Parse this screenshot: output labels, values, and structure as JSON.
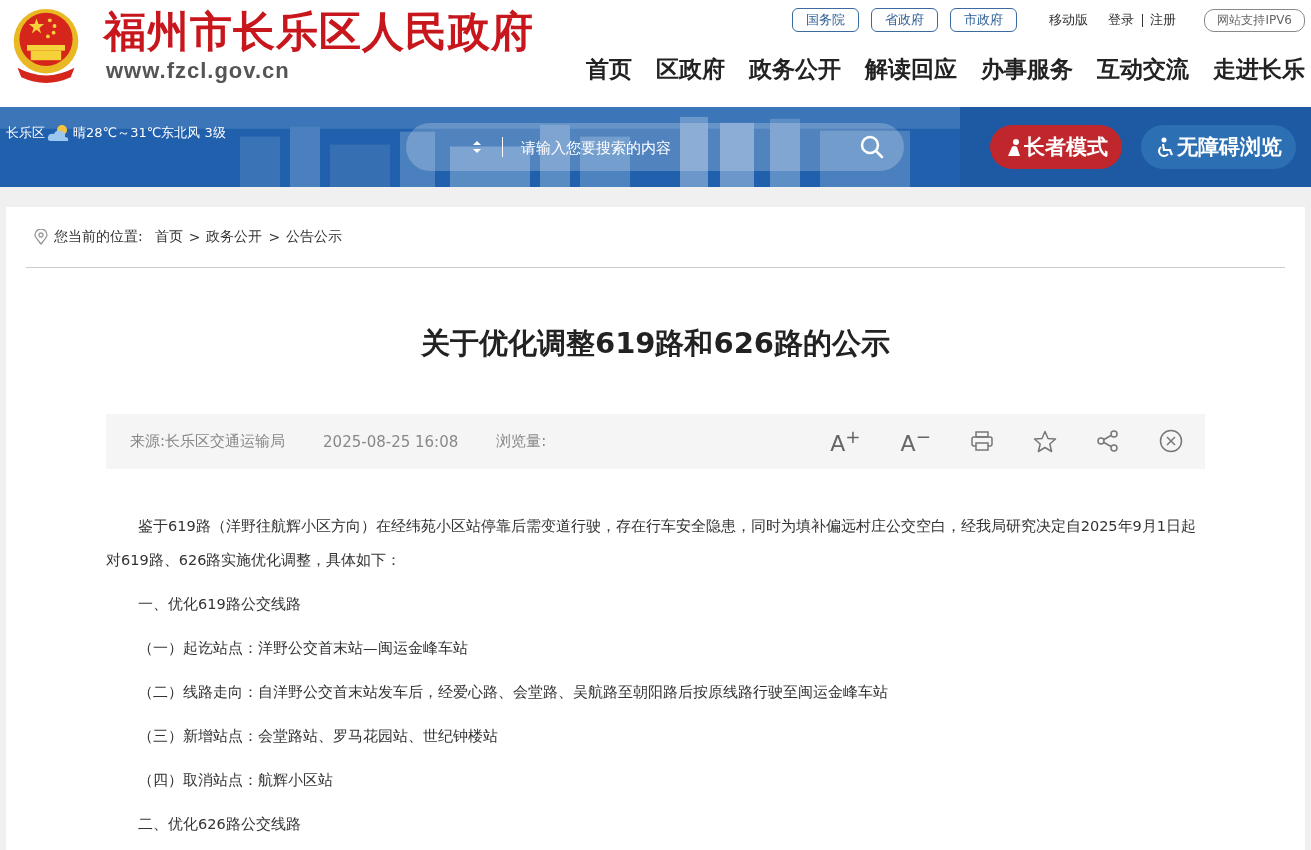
{
  "header": {
    "site_title": "福州市长乐区人民政府",
    "site_url": "www.fzcl.gov.cn",
    "gov_links": [
      {
        "label": "国务院"
      },
      {
        "label": "省政府"
      },
      {
        "label": "市政府"
      }
    ],
    "top_links": [
      {
        "label": "移动版"
      },
      {
        "label": "登录"
      },
      {
        "label": "注册"
      }
    ],
    "ipv6_badge": "网站支持IPV6",
    "nav": [
      {
        "label": "首页"
      },
      {
        "label": "区政府"
      },
      {
        "label": "政务公开"
      },
      {
        "label": "解读回应"
      },
      {
        "label": "办事服务"
      },
      {
        "label": "互动交流"
      },
      {
        "label": "走进长乐"
      }
    ]
  },
  "banner": {
    "kind": "picture",
    "location": "长乐区",
    "weather": "晴28℃～31℃东北风 3级",
    "search": {
      "placeholder": "请输入您要搜索的内容"
    },
    "elder_mode": "长者模式",
    "accessible_mode": "无障碍浏览"
  },
  "breadcrumb": {
    "label": "您当前的位置:",
    "items": [
      {
        "label": "首页"
      },
      {
        "label": "政务公开"
      },
      {
        "label": "公告公示"
      }
    ],
    "separator": ">"
  },
  "article": {
    "title": "关于优化调整619路和626路的公示",
    "meta": {
      "source": "来源:长乐区交通运输局",
      "date": "2025-08-25 16:08",
      "views_label": "浏览量:"
    },
    "tools": [
      {
        "kind": "text",
        "label": "A$^{+}$"
      },
      {
        "kind": "text",
        "label": "A$^{−}$"
      },
      {
        "kind": "print"
      },
      {
        "kind": "star"
      },
      {
        "kind": "share"
      },
      {
        "kind": "close"
      }
    ],
    "paragraphs": [
      {
        "kind": "body",
        "text": "鉴于619路（洋野往航辉小区方向）在经纬苑小区站停靠后需变道行驶，存在行车安全隐患，同时为填补偏远村庄公交空白，经我局研究决定自2025年9月1日起对619路、626路实施优化调整，具体如下："
      },
      {
        "kind": "heading",
        "text": "一、优化619路公交线路"
      },
      {
        "kind": "item",
        "text": "（一）起讫站点：洋野公交首末站—闽运金峰车站"
      },
      {
        "kind": "item",
        "text": "（二）线路走向：自洋野公交首末站发车后，经爱心路、会堂路、吴航路至朝阳路后按原线路行驶至闽运金峰车站"
      },
      {
        "kind": "item",
        "text": "（三）新增站点：会堂路站、罗马花园站、世纪钟楼站"
      },
      {
        "kind": "item",
        "text": "（四）取消站点：航辉小区站"
      },
      {
        "kind": "heading",
        "text": "二、优化626路公交线路"
      }
    ]
  }
}
